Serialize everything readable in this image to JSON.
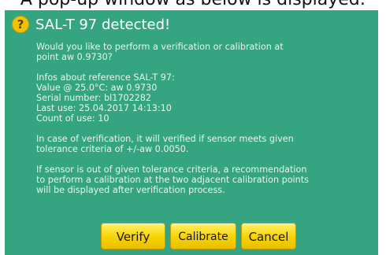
{
  "caption": "A pop-up window as below is displayed:",
  "dialog": {
    "title": "SAL-T 97 detected!",
    "icon": "help-icon",
    "question": [
      "Would you like to perform a verification or calibration at",
      "point aw 0.9730?"
    ],
    "infos": [
      "Infos about reference SAL-T 97:",
      "Value @ 25.0°C: aw 0.9730",
      "Serial number: bl1702282",
      "Last use: 25.04.2017 14:13:10",
      "Count of use: 10"
    ],
    "verification_note": [
      "In case of verification, it will verified if sensor meets given",
      "tolerance criteria of +/-aw 0.0050."
    ],
    "tolerance_note": [
      "If sensor is out of given tolerance criteria, a recommendation",
      "to perform a calibration at the two adjacent calibration points",
      "will be displayed after verification process."
    ],
    "buttons": {
      "verify": "Verify",
      "calibrate": "Calibrate",
      "cancel": "Cancel"
    }
  },
  "colors": {
    "dialog_background": "#35a481",
    "button": "#f6d200",
    "icon": "#f2c200"
  }
}
